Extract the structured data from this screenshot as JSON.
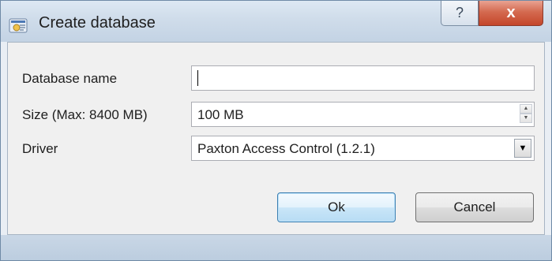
{
  "window": {
    "title": "Create database",
    "help_label": "?",
    "close_label": "x"
  },
  "form": {
    "name_label": "Database name",
    "name_value": "",
    "size_label": "Size (Max: 8400 MB)",
    "size_value": "100 MB",
    "driver_label": "Driver",
    "driver_value": "Paxton Access Control (1.2.1)"
  },
  "buttons": {
    "ok_label": "Ok",
    "cancel_label": "Cancel"
  },
  "icons": {
    "app": "database-app-icon",
    "spin_up": "spin-up-icon",
    "spin_down": "spin-down-icon",
    "dropdown": "chevron-down-icon"
  },
  "colors": {
    "close_button": "#c4462a",
    "ok_border": "#3c7fb1"
  }
}
